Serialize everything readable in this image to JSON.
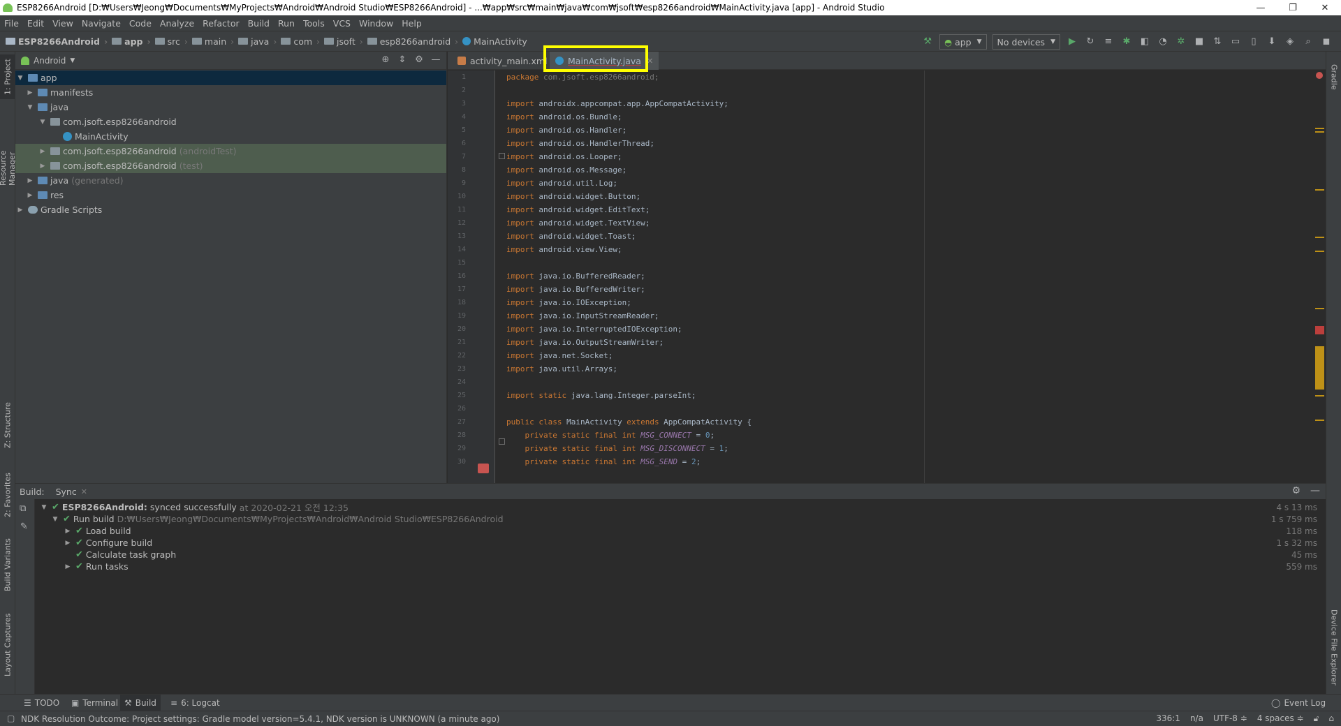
{
  "window": {
    "title": "ESP8266Android [D:₩Users₩Jeong₩Documents₩MyProjects₩Android₩Android Studio₩ESP8266Android] - ...₩app₩src₩main₩java₩com₩jsoft₩esp8266android₩MainActivity.java [app] - Android Studio",
    "minimize": "—",
    "restore": "❐",
    "close": "✕"
  },
  "menu": [
    "File",
    "Edit",
    "View",
    "Navigate",
    "Code",
    "Analyze",
    "Refactor",
    "Build",
    "Run",
    "Tools",
    "VCS",
    "Window",
    "Help"
  ],
  "breadcrumbs": [
    "ESP8266Android",
    "app",
    "src",
    "main",
    "java",
    "com",
    "jsoft",
    "esp8266android",
    "MainActivity"
  ],
  "toolbar": {
    "run_config": "app",
    "device": "No devices"
  },
  "project_panel": {
    "view_mode": "Android",
    "tree": [
      {
        "label": "app",
        "hint": ""
      },
      {
        "label": "manifests",
        "hint": ""
      },
      {
        "label": "java",
        "hint": ""
      },
      {
        "label": "com.jsoft.esp8266android",
        "hint": ""
      },
      {
        "label": "MainActivity",
        "hint": ""
      },
      {
        "label": "com.jsoft.esp8266android",
        "hint": "(androidTest)"
      },
      {
        "label": "com.jsoft.esp8266android",
        "hint": "(test)"
      },
      {
        "label": "java",
        "hint": "(generated)"
      },
      {
        "label": "res",
        "hint": ""
      },
      {
        "label": "Gradle Scripts",
        "hint": ""
      }
    ]
  },
  "editor": {
    "tabs": [
      {
        "label": "activity_main.xml"
      },
      {
        "label": "MainActivity.java"
      }
    ],
    "line_numbers": [
      "1",
      "2",
      "3",
      "4",
      "5",
      "6",
      "7",
      "8",
      "9",
      "10",
      "11",
      "12",
      "13",
      "14",
      "15",
      "16",
      "17",
      "18",
      "19",
      "20",
      "21",
      "22",
      "23",
      "24",
      "25",
      "26",
      "27",
      "28",
      "29",
      "30"
    ]
  },
  "left_stripe": {
    "project": "1: Project",
    "resource_manager": "Resource Manager",
    "structure": "Z: Structure",
    "favorites": "2: Favorites",
    "build_variants": "Build Variants",
    "layout_captures": "Layout Captures"
  },
  "right_stripe": {
    "gradle": "Gradle",
    "device_file_explorer": "Device File Explorer"
  },
  "build_panel": {
    "title": "Build:",
    "sync_tab": "Sync",
    "rows": [
      {
        "label": "ESP8266Android:",
        "detail": "synced successfully",
        "meta": "at 2020-02-21 오전 12:35",
        "time": "4 s 13 ms"
      },
      {
        "label": "Run build",
        "meta": "D:₩Users₩Jeong₩Documents₩MyProjects₩Android₩Android Studio₩ESP8266Android",
        "time": "1 s 759 ms"
      },
      {
        "label": "Load build",
        "time": "118 ms"
      },
      {
        "label": "Configure build",
        "time": "1 s 32 ms"
      },
      {
        "label": "Calculate task graph",
        "time": "45 ms"
      },
      {
        "label": "Run tasks",
        "time": "559 ms"
      }
    ]
  },
  "bottom_tabs": {
    "todo": "TODO",
    "terminal": "Terminal",
    "build": "Build",
    "logcat": "6: Logcat",
    "event_log": "Event Log"
  },
  "status_bar": {
    "message": "NDK Resolution Outcome: Project settings: Gradle model version=5.4.1, NDK version is UNKNOWN (a minute ago)",
    "position": "336:1",
    "line_sep": "n/a",
    "encoding": "UTF-8 ≑",
    "indent": "4 spaces ≑"
  },
  "colors": {
    "highlight": "#ffff00",
    "check": "#59a869",
    "keyword": "#cc7832"
  }
}
